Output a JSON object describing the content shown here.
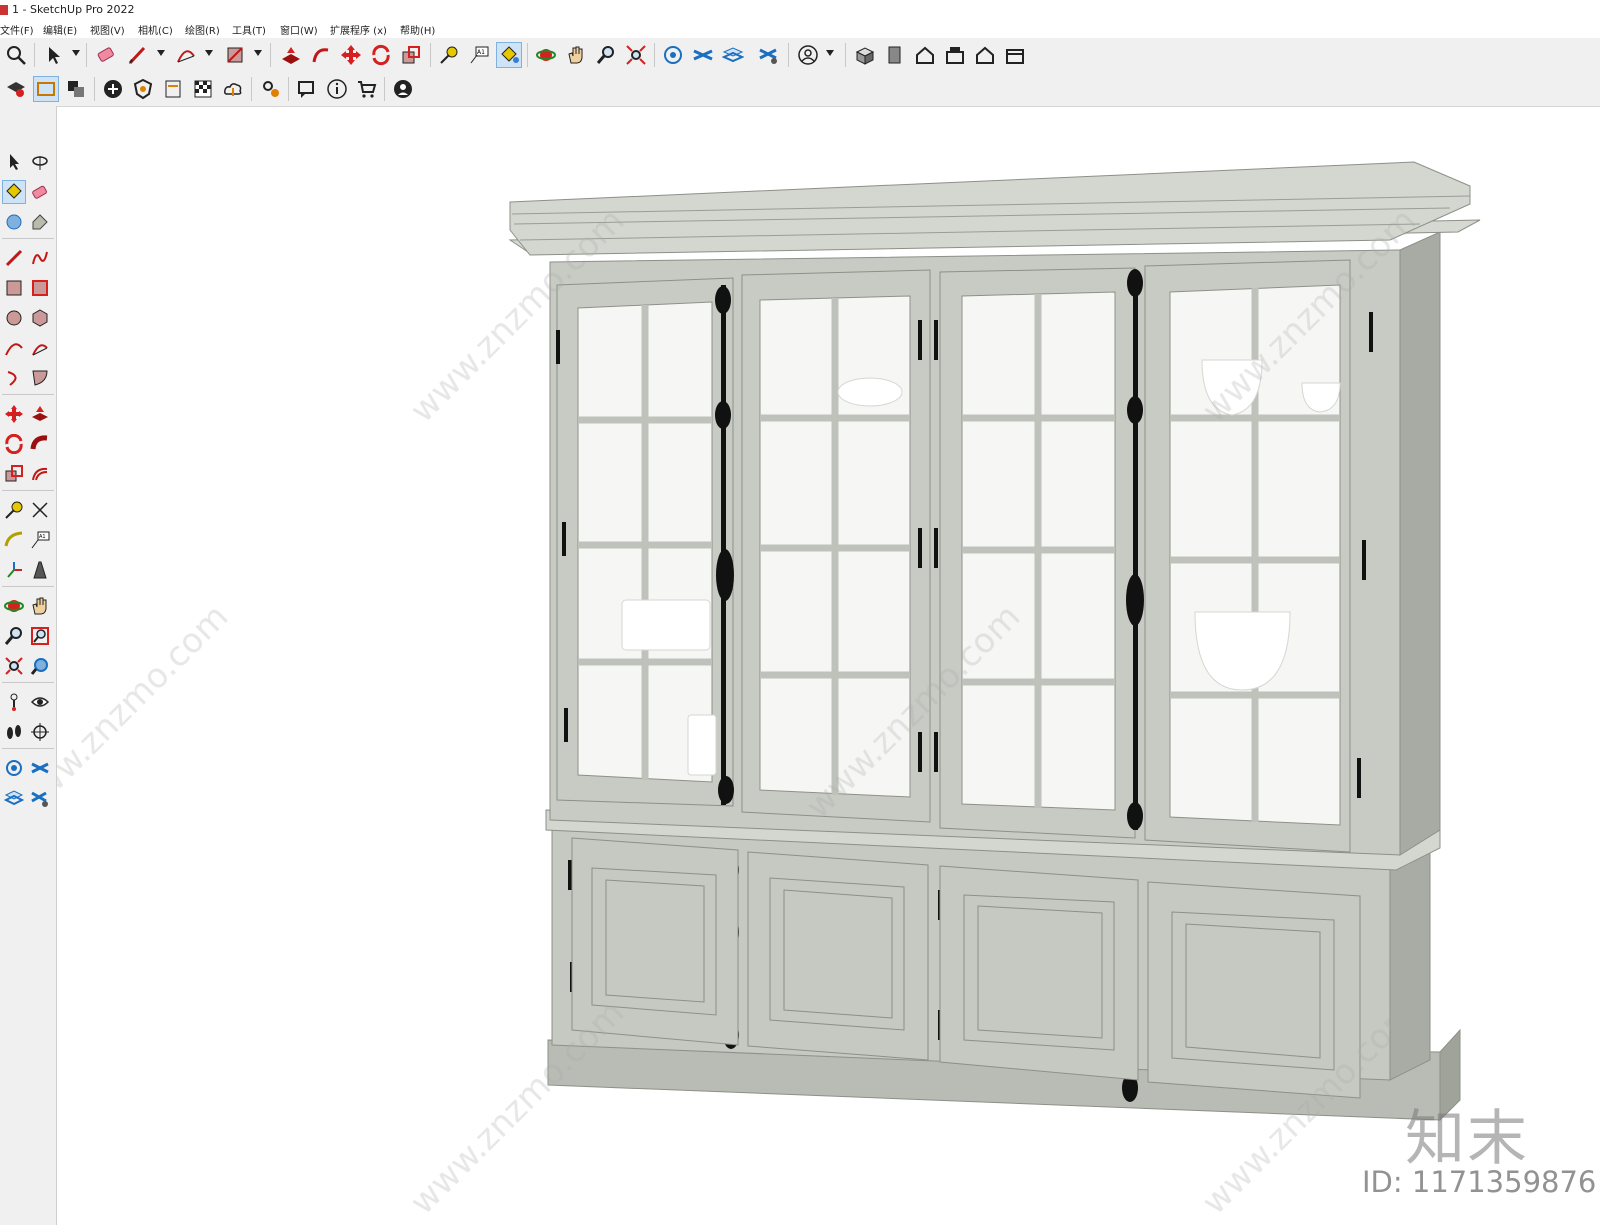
{
  "window": {
    "title": "1 - SketchUp Pro 2022"
  },
  "menu": [
    {
      "label": "文件(F)"
    },
    {
      "label": "编辑(E)"
    },
    {
      "label": "视图(V)"
    },
    {
      "label": "相机(C)"
    },
    {
      "label": "绘图(R)"
    },
    {
      "label": "工具(T)"
    },
    {
      "label": "窗口(W)"
    },
    {
      "label": "扩展程序 (x)"
    },
    {
      "label": "帮助(H)"
    }
  ],
  "toolbar_icons": {
    "search": "search-icon",
    "select": "select-arrow-icon",
    "eraser": "eraser-icon",
    "pencil": "pencil-icon",
    "arc": "arc-icon",
    "rectangle": "rectangle-icon",
    "pushpull": "push-pull-icon",
    "followme": "follow-me-icon",
    "move": "move-icon",
    "rotate": "rotate-icon",
    "scale": "scale-icon",
    "tape": "tape-measure-icon",
    "text": "text-icon",
    "paint": "paint-bucket-icon",
    "orbit": "orbit-icon",
    "pan": "pan-icon",
    "zoom": "zoom-icon",
    "zoom_extents": "zoom-extents-icon",
    "user": "account-icon"
  },
  "watermark": {
    "brand": "知末",
    "id_text": "ID: 1171359876"
  },
  "colors": {
    "toolbar_bg": "#f0f0f0",
    "viewport_bg": "#ffffff",
    "cabinet": "#c8cbc3",
    "cabinet_dark": "#9fa39a",
    "glass": "#f4f5f3",
    "hardware": "#111111",
    "accent_red": "#d62020"
  }
}
